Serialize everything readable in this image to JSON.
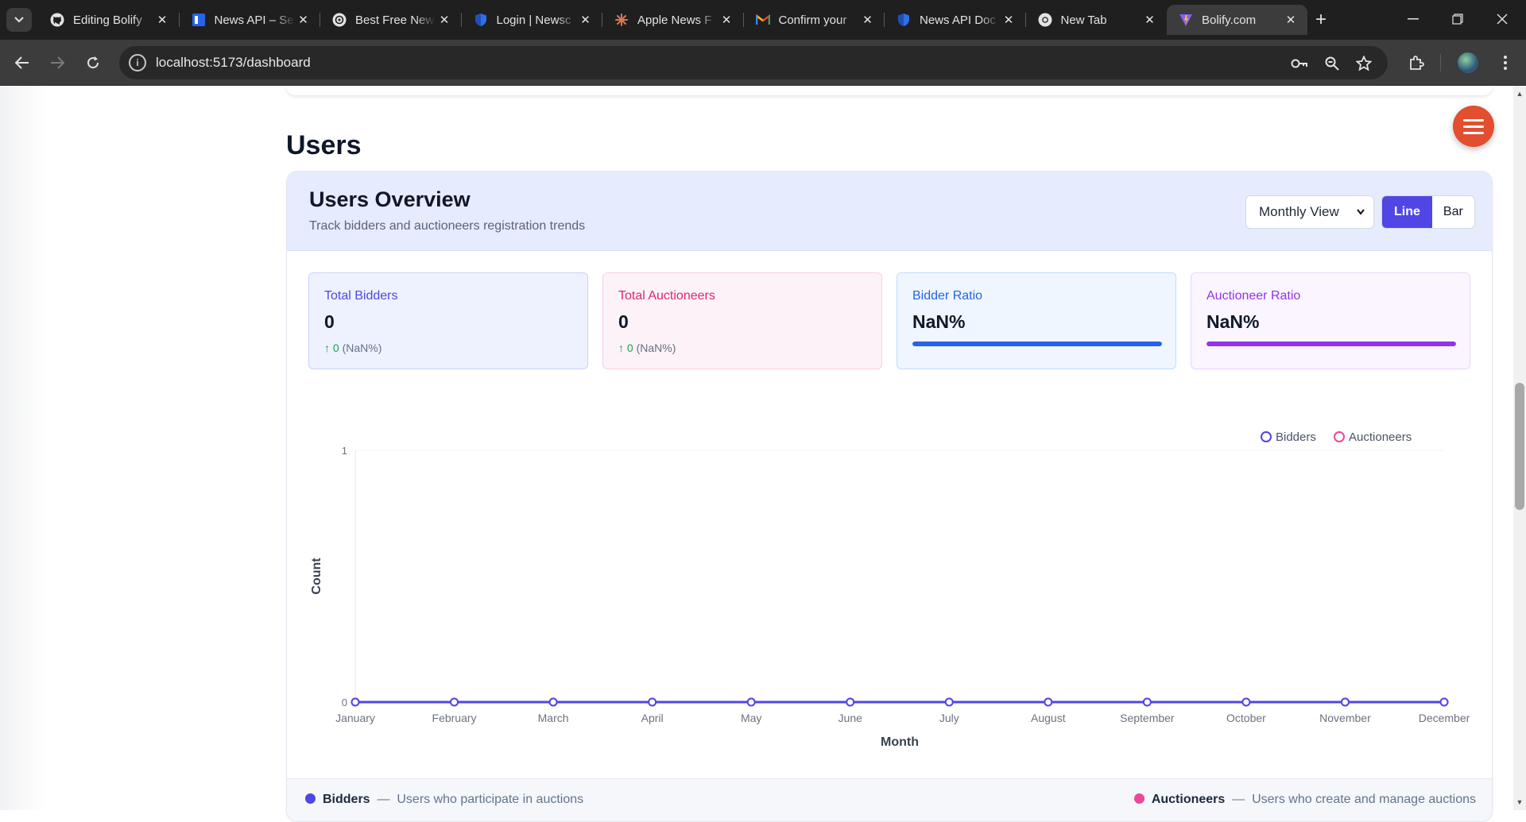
{
  "browser": {
    "tabs": [
      {
        "title": "Editing Bolify",
        "icon": "github-icon"
      },
      {
        "title": "News API – Se",
        "icon": "newsapi-icon"
      },
      {
        "title": "Best Free New",
        "icon": "openai-icon"
      },
      {
        "title": "Login | Newsc",
        "icon": "shield-icon"
      },
      {
        "title": "Apple News F",
        "icon": "claude-icon"
      },
      {
        "title": "Confirm your",
        "icon": "gmail-icon"
      },
      {
        "title": "News API Doc",
        "icon": "shield-icon"
      },
      {
        "title": "New Tab",
        "icon": "chrome-icon"
      },
      {
        "title": "Bolify.com",
        "icon": "vite-icon"
      }
    ],
    "active_tab": 8,
    "url": "localhost:5173/dashboard"
  },
  "section": {
    "title": "Users"
  },
  "overview": {
    "title": "Users Overview",
    "subtitle": "Track bidders and auctioneers registration trends",
    "view_select": {
      "selected": "Monthly View"
    },
    "chart_toggle": {
      "line": "Line",
      "bar": "Bar",
      "active": "Line"
    }
  },
  "stats": [
    {
      "label": "Total Bidders",
      "value": "0",
      "change_amount": "0",
      "change_pct": "(NaN%)",
      "accent": "#4f46e5",
      "bg": "#eef2ff",
      "border": "#c7d2fe"
    },
    {
      "label": "Total Auctioneers",
      "value": "0",
      "change_amount": "0",
      "change_pct": "(NaN%)",
      "accent": "#db2777",
      "bg": "#fdf2f8",
      "border": "#fbcfe8"
    },
    {
      "label": "Bidder Ratio",
      "value": "NaN%",
      "progress": 1,
      "accent": "#2563eb",
      "bg": "#eff6ff",
      "border": "#bfdbfe",
      "bar_color": "#2563eb"
    },
    {
      "label": "Auctioneer Ratio",
      "value": "NaN%",
      "progress": 1,
      "accent": "#9333ea",
      "bg": "#faf5ff",
      "border": "#e9d5ff",
      "bar_color": "#9333ea"
    }
  ],
  "chart_data": {
    "type": "line",
    "categories": [
      "January",
      "February",
      "March",
      "April",
      "May",
      "June",
      "July",
      "August",
      "September",
      "October",
      "November",
      "December"
    ],
    "series": [
      {
        "name": "Bidders",
        "values": [
          0,
          0,
          0,
          0,
          0,
          0,
          0,
          0,
          0,
          0,
          0,
          0
        ],
        "color": "#4f46e5"
      },
      {
        "name": "Auctioneers",
        "values": [
          0,
          0,
          0,
          0,
          0,
          0,
          0,
          0,
          0,
          0,
          0,
          0
        ],
        "color": "#ec4899"
      }
    ],
    "xlabel": "Month",
    "ylabel": "Count",
    "ylim": [
      0,
      1
    ],
    "yticks": [
      "0",
      "1"
    ],
    "legend_position": "top-right",
    "grid": false
  },
  "footer": {
    "bidders": {
      "name": "Bidders",
      "desc": "Users who participate in auctions",
      "color": "#4f46e5"
    },
    "auctioneers": {
      "name": "Auctioneers",
      "desc": "Users who create and manage auctions",
      "color": "#ec4899"
    }
  }
}
